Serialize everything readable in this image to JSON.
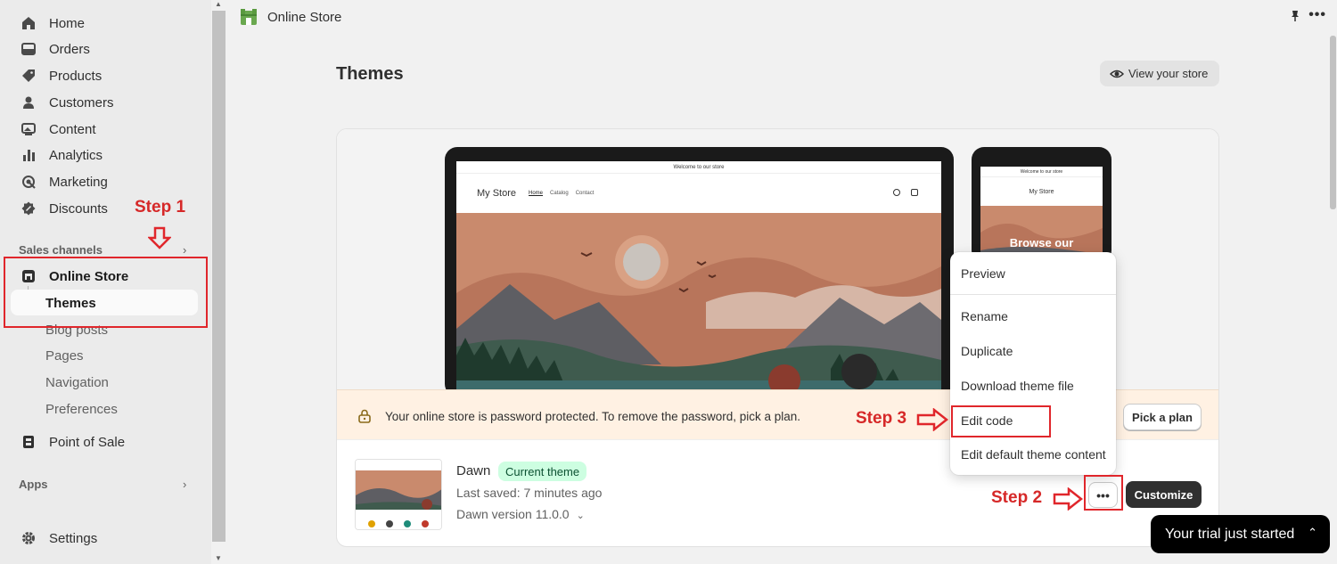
{
  "sidebar": {
    "items": [
      {
        "label": "Home",
        "icon": "home-icon"
      },
      {
        "label": "Orders",
        "icon": "orders-icon"
      },
      {
        "label": "Products",
        "icon": "tag-icon"
      },
      {
        "label": "Customers",
        "icon": "person-icon"
      },
      {
        "label": "Content",
        "icon": "content-icon"
      },
      {
        "label": "Analytics",
        "icon": "bar-chart-icon"
      },
      {
        "label": "Marketing",
        "icon": "target-icon"
      },
      {
        "label": "Discounts",
        "icon": "discount-icon"
      }
    ],
    "sales_channels_label": "Sales channels",
    "online_store_label": "Online Store",
    "sub_items": [
      "Themes",
      "Blog posts",
      "Pages",
      "Navigation",
      "Preferences"
    ],
    "point_of_sale_label": "Point of Sale",
    "apps_label": "Apps",
    "settings_label": "Settings"
  },
  "topbar": {
    "title": "Online Store"
  },
  "page": {
    "title": "Themes",
    "view_store_label": "View your store"
  },
  "preview": {
    "announcement": "Welcome to our store",
    "store_name": "My Store",
    "nav": [
      "Home",
      "Catalog",
      "Contact"
    ],
    "phone_overlay": "Browse our"
  },
  "banner": {
    "message": "Your online store is password protected. To remove the password, pick a plan.",
    "pick_plan_label": "Pick a plan"
  },
  "theme": {
    "name": "Dawn",
    "badge": "Current theme",
    "last_saved": "Last saved: 7 minutes ago",
    "version": "Dawn version 11.0.0",
    "customize_label": "Customize",
    "more_label": "•••"
  },
  "menu": {
    "items": [
      "Preview",
      "Rename",
      "Duplicate",
      "Download theme file",
      "Edit code",
      "Edit default theme content"
    ]
  },
  "annotations": {
    "step1": "Step 1",
    "step2": "Step 2",
    "step3": "Step 3",
    "color": "#d62828"
  },
  "trial": {
    "label": "Your trial just started"
  }
}
